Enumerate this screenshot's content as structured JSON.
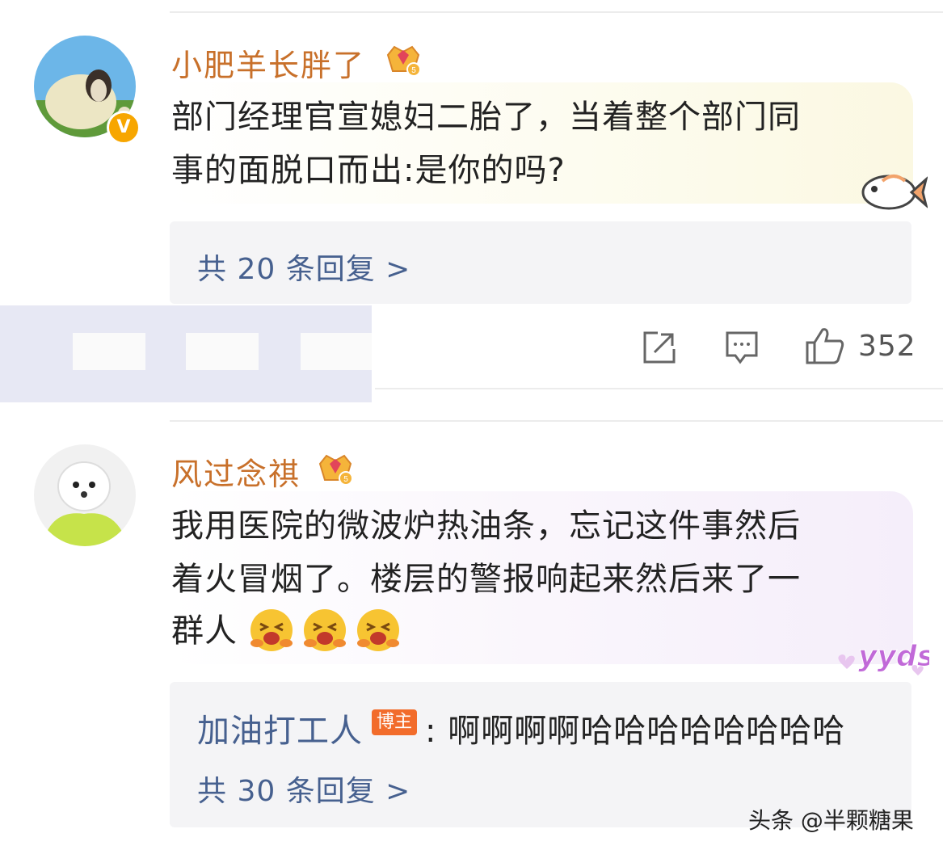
{
  "comments": [
    {
      "username": "小肥羊长胖了",
      "crown_level": "5",
      "verified": "V",
      "text_line1": "部门经理官宣媳妇二胎了，当着整个部门同",
      "text_line2": "事的面脱口而出:是你的吗?",
      "replies_label": "共 20 条回复 >"
    },
    {
      "username": "风过念祺",
      "crown_level": "5",
      "text_line1": "我用医院的微波炉热油条，忘记这件事然后",
      "text_line2": "着火冒烟了。楼层的警报响起来然后来了一",
      "text_line3": "群人",
      "sticker_text": "yyds",
      "reply_preview": {
        "user": "加油打工人",
        "badge": "博主",
        "text": ": 啊啊啊啊哈哈哈哈哈哈哈哈"
      },
      "replies_label": "共 30 条回复 >"
    }
  ],
  "actions": {
    "share_icon": "share-icon",
    "comment_icon": "comment-icon",
    "like_icon": "thumbs-up-icon",
    "likes": "352"
  },
  "watermark": "头条 @半颗糖果",
  "colors": {
    "username": "#c8702a",
    "link": "#46608f",
    "badge": "#f26c2b",
    "verified": "#f7a600"
  }
}
